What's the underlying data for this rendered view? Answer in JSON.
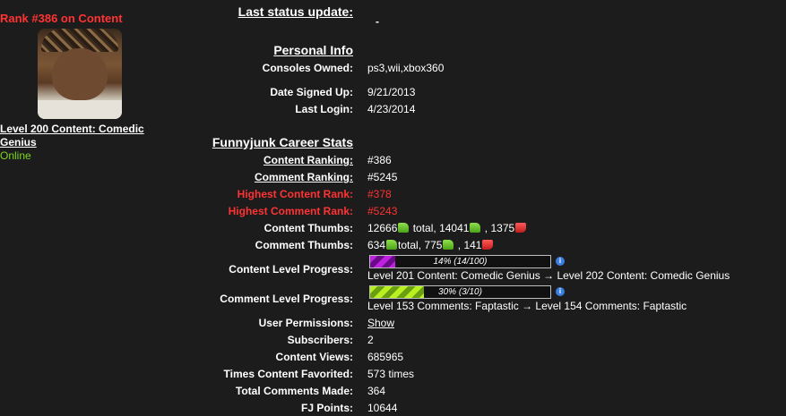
{
  "sidebar": {
    "rank_title": "Rank #386 on Content",
    "level_link": "Level 200 Content: Comedic Genius",
    "status": "Online"
  },
  "status_update": {
    "label": "Last status update:",
    "value": "-"
  },
  "personal": {
    "heading": "Personal Info",
    "consoles_label": "Consoles Owned:",
    "consoles": "ps3,wii,xbox360",
    "signed_up_label": "Date Signed Up:",
    "signed_up": "9/21/2013",
    "last_login_label": "Last Login:",
    "last_login": "4/23/2014"
  },
  "career": {
    "heading": "Funnyjunk Career Stats",
    "content_ranking_label": "Content Ranking:",
    "content_ranking": "#386",
    "comment_ranking_label": "Comment Ranking:",
    "comment_ranking": "#5245",
    "highest_content_label": "Highest Content Rank:",
    "highest_content": "#378",
    "highest_comment_label": "Highest Comment Rank:",
    "highest_comment": "#5243",
    "content_thumbs_label": "Content Thumbs:",
    "content_thumbs": {
      "total": "12666",
      "total_word": "total,",
      "up": "14041",
      "down": "1375"
    },
    "comment_thumbs_label": "Comment Thumbs:",
    "comment_thumbs": {
      "total": "634",
      "total_word": "total,",
      "up": "775",
      "down": "141"
    },
    "content_progress_label": "Content Level Progress:",
    "content_progress": {
      "text": "14% (14/100)",
      "fraction": 0.14,
      "caption": "Level 201 Content: Comedic Genius → Level 202 Content: Comedic Genius"
    },
    "comment_progress_label": "Comment Level Progress:",
    "comment_progress": {
      "text": "30% (3/10)",
      "fraction": 0.3,
      "caption": "Level 153 Comments: Faptastic → Level 154 Comments: Faptastic"
    },
    "permissions_label": "User Permissions:",
    "permissions": "Show",
    "subscribers_label": "Subscribers:",
    "subscribers": "2",
    "views_label": "Content Views:",
    "views": "685965",
    "favorited_label": "Times Content Favorited:",
    "favorited": "573 times",
    "comments_label": "Total Comments Made:",
    "comments": "364",
    "fj_points_label": "FJ Points:",
    "fj_points": "10644"
  },
  "colors": {
    "background": "#1c1c1c",
    "accent_red": "#ff3333",
    "online_green": "#7cd620",
    "info_blue": "#3a7ee0"
  }
}
